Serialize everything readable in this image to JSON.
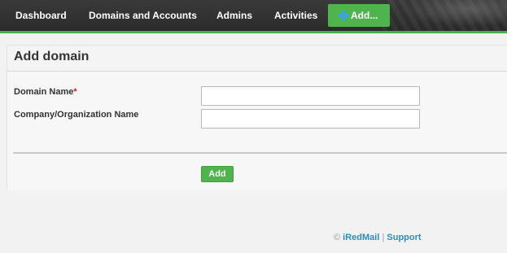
{
  "nav": {
    "items": [
      {
        "label": "Dashboard"
      },
      {
        "label": "Domains and Accounts"
      },
      {
        "label": "Admins"
      },
      {
        "label": "Activities"
      }
    ],
    "add_label": "Add..."
  },
  "form": {
    "title": "Add domain",
    "domain_name_label": "Domain Name",
    "required_mark": "*",
    "company_label": "Company/Organization Name",
    "domain_name_value": "",
    "company_value": "",
    "submit_label": "Add"
  },
  "footer": {
    "copyright": "©",
    "brand": "iRedMail",
    "separator": "|",
    "support": "Support"
  },
  "colors": {
    "accent_green": "#4fb44e",
    "link_blue": "#2a8fbd",
    "navbar_bg": "#2b2b2b"
  }
}
